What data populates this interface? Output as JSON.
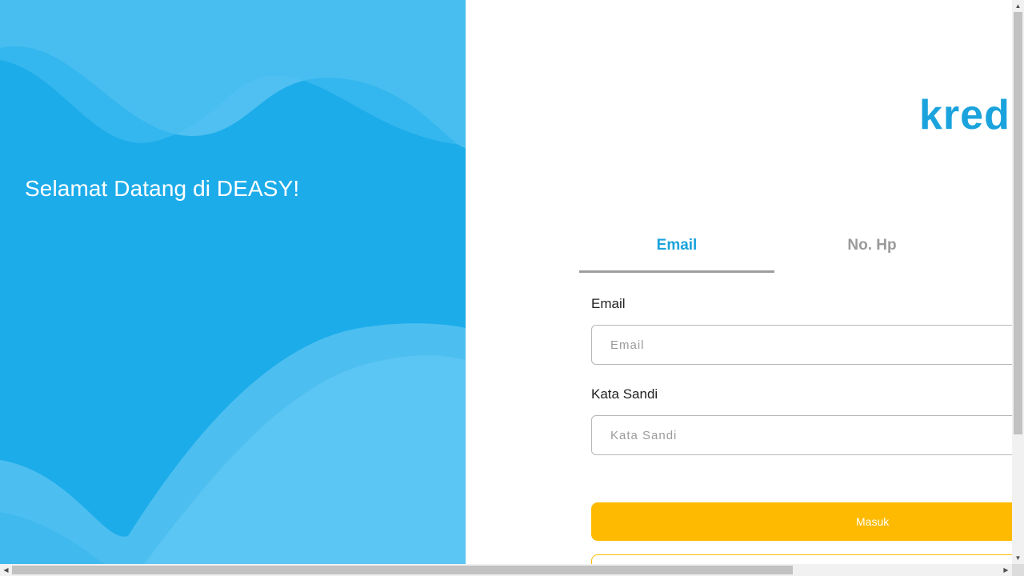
{
  "hero": {
    "title": "Selamat Datang di DEASY!"
  },
  "brand": {
    "logo_text": "kred",
    "logo_color": "#1aa3dc"
  },
  "tabs": [
    {
      "label": "Email",
      "active": true
    },
    {
      "label": "No. Hp",
      "active": false
    }
  ],
  "form": {
    "email_label": "Email",
    "email_placeholder": "Email",
    "email_value": "",
    "password_label": "Kata Sandi",
    "password_placeholder": "Kata Sandi",
    "password_value": "",
    "submit_label": "Masuk"
  },
  "colors": {
    "hero_bg": "#1dacea",
    "accent": "#1aa3dc",
    "button": "#fdba00",
    "inactive_tab": "#9a9a9a"
  }
}
